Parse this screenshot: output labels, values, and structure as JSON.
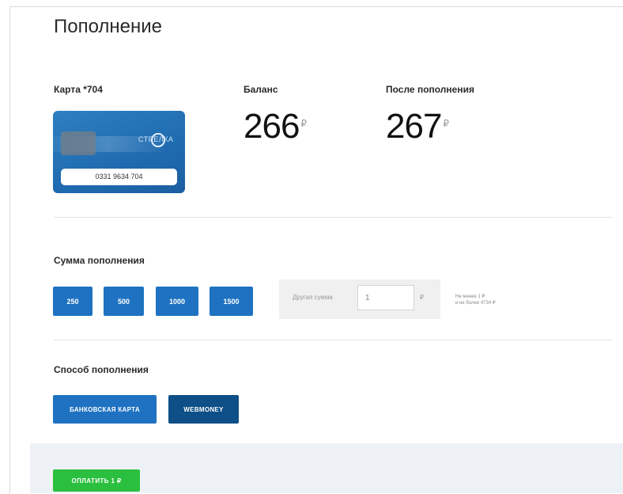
{
  "page": {
    "title": "Пополнение"
  },
  "card": {
    "label": "Карта *704",
    "number": "0331 9634 704",
    "logo_text": "СТРЕЛКА"
  },
  "balance": {
    "label": "Баланс",
    "value": "266",
    "currency": "₽"
  },
  "after_topup": {
    "label": "После пополнения",
    "value": "267",
    "currency": "₽"
  },
  "amount": {
    "label": "Сумма пополнения",
    "presets": [
      "250",
      "500",
      "1000",
      "1500"
    ],
    "other_label": "Другая сумма",
    "other_value": "1",
    "other_currency": "₽",
    "hint_line1": "Не менее 1 ₽",
    "hint_line2": "и не более 4734 ₽"
  },
  "method": {
    "label": "Способ пополнения",
    "options": [
      "БАНКОВСКАЯ КАРТА",
      "WEBMONEY"
    ],
    "selected": "WEBMONEY"
  },
  "pay": {
    "label": "ОПЛАТИТЬ   1 ₽"
  },
  "colors": {
    "primary": "#1f72c1",
    "primary_dark": "#0d4f86",
    "pay_green": "#2bbf3f",
    "footer_bg": "#eef2f6"
  }
}
